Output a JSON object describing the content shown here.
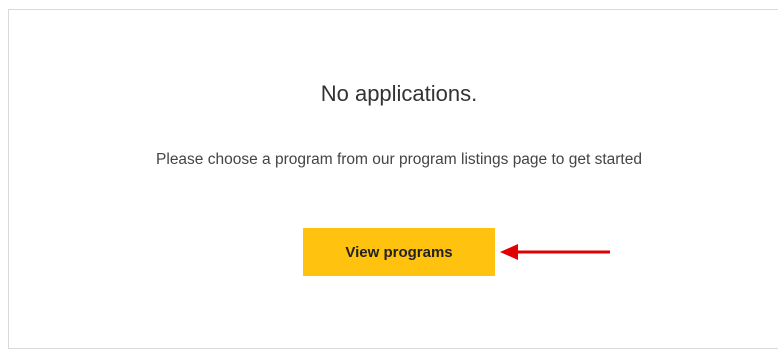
{
  "empty_state": {
    "title": "No applications.",
    "subtitle": "Please choose a program from our program listings page to get started",
    "button_label": "View programs"
  },
  "colors": {
    "button_bg": "#ffc20e",
    "arrow": "#e00000",
    "panel_border": "#d9d9d9"
  },
  "icons": {
    "annotation": "left-arrow-icon"
  }
}
